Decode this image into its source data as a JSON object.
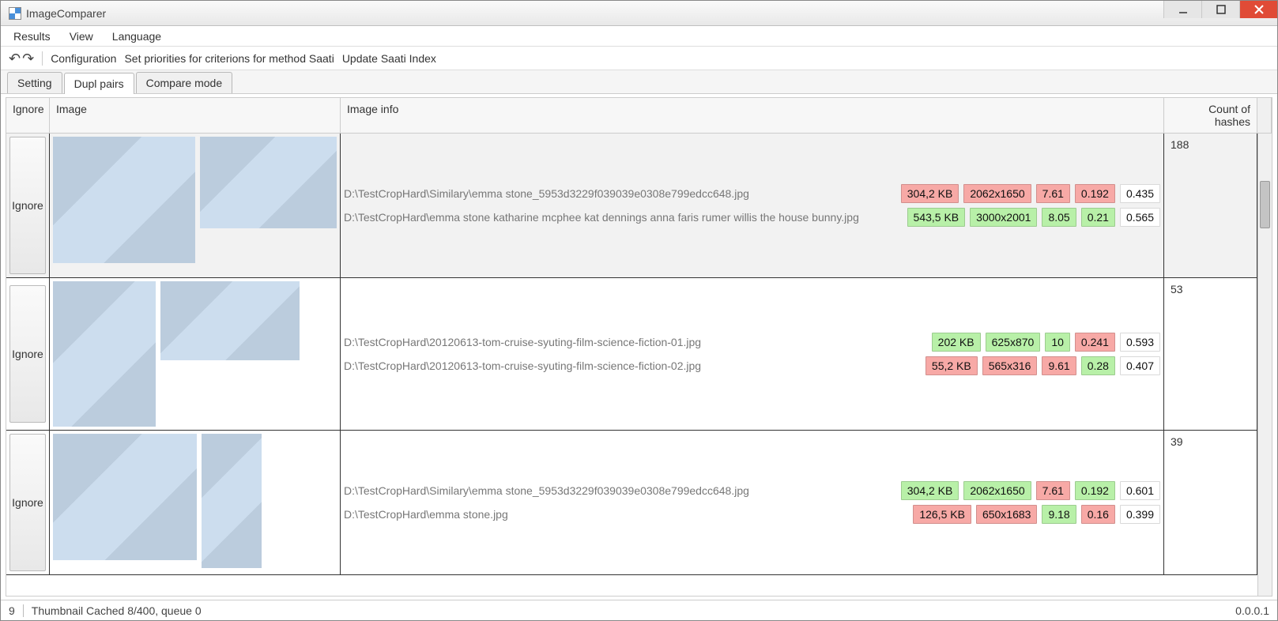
{
  "window": {
    "title": "ImageComparer"
  },
  "menubar": [
    "Results",
    "View",
    "Language"
  ],
  "configbar": [
    "Configuration",
    "Set priorities for criterions for method Saati",
    "Update Saati Index"
  ],
  "tabs": [
    "Setting",
    "Dupl pairs",
    "Compare mode"
  ],
  "active_tab": 1,
  "columns": {
    "ignore": "Ignore",
    "image": "Image",
    "info": "Image info",
    "count": "Count of hashes"
  },
  "ignore_label": "Ignore",
  "rows": [
    {
      "selected": true,
      "count": "188",
      "thumbs": [
        [
          182,
          160
        ],
        [
          175,
          116
        ]
      ],
      "lines": [
        {
          "path": "D:\\TestCropHard\\Similary\\emma stone_5953d3229f039039e0308e799edcc648.jpg",
          "chips": [
            [
              "304,2 KB",
              "r"
            ],
            [
              "2062x1650",
              "r"
            ],
            [
              "7.61",
              "r"
            ],
            [
              "0.192",
              "r"
            ],
            [
              "0.435",
              "w"
            ]
          ]
        },
        {
          "path": "D:\\TestCropHard\\emma stone katharine mcphee kat dennings anna faris rumer willis the house bunny.jpg",
          "chips": [
            [
              "543,5 KB",
              "g"
            ],
            [
              "3000x2001",
              "g"
            ],
            [
              "8.05",
              "g"
            ],
            [
              "0.21",
              "g"
            ],
            [
              "0.565",
              "w"
            ]
          ]
        }
      ]
    },
    {
      "selected": false,
      "count": "53",
      "thumbs": [
        [
          130,
          184
        ],
        [
          176,
          100
        ]
      ],
      "lines": [
        {
          "path": "D:\\TestCropHard\\20120613-tom-cruise-syuting-film-science-fiction-01.jpg",
          "chips": [
            [
              "202 KB",
              "g"
            ],
            [
              "625x870",
              "g"
            ],
            [
              "10",
              "g"
            ],
            [
              "0.241",
              "r"
            ],
            [
              "0.593",
              "w"
            ]
          ]
        },
        {
          "path": "D:\\TestCropHard\\20120613-tom-cruise-syuting-film-science-fiction-02.jpg",
          "chips": [
            [
              "55,2 KB",
              "r"
            ],
            [
              "565x316",
              "r"
            ],
            [
              "9.61",
              "r"
            ],
            [
              "0.28",
              "g"
            ],
            [
              "0.407",
              "w"
            ]
          ]
        }
      ]
    },
    {
      "selected": false,
      "count": "39",
      "thumbs": [
        [
          182,
          160
        ],
        [
          76,
          170
        ]
      ],
      "lines": [
        {
          "path": "D:\\TestCropHard\\Similary\\emma stone_5953d3229f039039e0308e799edcc648.jpg",
          "chips": [
            [
              "304,2 KB",
              "g"
            ],
            [
              "2062x1650",
              "g"
            ],
            [
              "7.61",
              "r"
            ],
            [
              "0.192",
              "g"
            ],
            [
              "0.601",
              "w"
            ]
          ]
        },
        {
          "path": "D:\\TestCropHard\\emma stone.jpg",
          "chips": [
            [
              "126,5 KB",
              "r"
            ],
            [
              "650x1683",
              "r"
            ],
            [
              "9.18",
              "g"
            ],
            [
              "0.16",
              "r"
            ],
            [
              "0.399",
              "w"
            ]
          ]
        }
      ]
    }
  ],
  "statusbar": {
    "left_count": "9",
    "cache": "Thumbnail Cached 8/400, queue 0",
    "version": "0.0.0.1"
  }
}
